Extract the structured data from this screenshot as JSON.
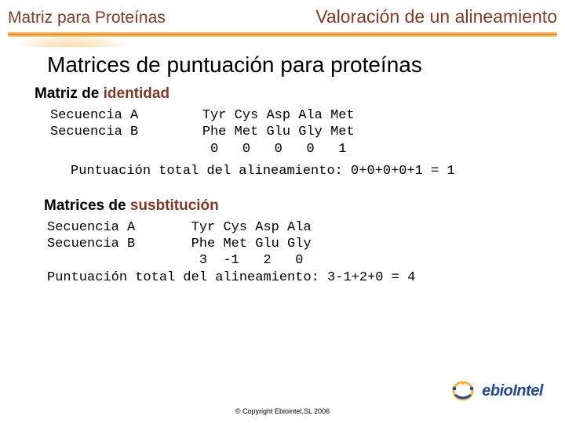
{
  "header": {
    "left": "Matriz para Proteínas",
    "right": "Valoración de un alineamiento"
  },
  "title": "Matrices de puntuación para proteínas",
  "identity": {
    "heading_prefix": "Matriz de ",
    "heading_accent": "identidad",
    "seqA_label": "Secuencia A",
    "seqB_label": "Secuencia B",
    "seqA": "Tyr Cys Asp Ala Met",
    "seqB": "Phe Met Glu Gly Met",
    "scores": " 0   0   0   0   1",
    "total_line": "Puntuación total del alineamiento: 0+0+0+0+1 = 1"
  },
  "substitution": {
    "heading_prefix": "Matrices de ",
    "heading_accent": "susbtitución",
    "seqA_label": "Secuencia A",
    "seqB_label": "Secuencia B",
    "seqA": "Tyr Cys Asp Ala",
    "seqB": "Phe Met Glu Gly",
    "scores": " 3  -1   2   0",
    "total_line": "Puntuación total del alineamiento: 3-1+2+0 = 4"
  },
  "logo_text": "ebioIntel",
  "copyright": "© Copyright Ebiointel,SL 2006"
}
